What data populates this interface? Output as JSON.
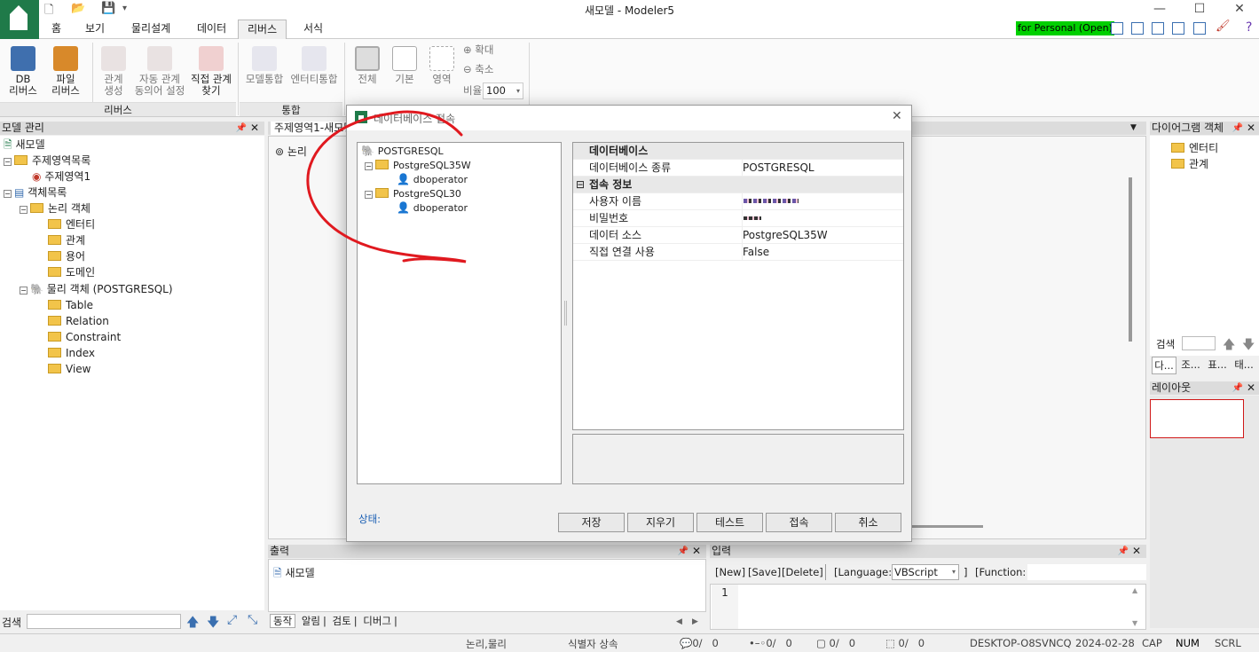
{
  "app": {
    "title": "새모델 - Modeler5",
    "license": "for Personal (Open)"
  },
  "menu": [
    "홈",
    "보기",
    "물리설계",
    "데이터",
    "리버스",
    "서식"
  ],
  "ribbon": {
    "db_reverse": "DB\n리버스",
    "file_reverse": "파일\n리버스",
    "rel_gen": "관계\n생성",
    "auto_rel": "자동 관계\n동의어 설정",
    "direct_rel": "직접 관계\n찾기",
    "group_reverse": "리버스",
    "model_merge": "모델통합",
    "entity_merge": "엔터티통합",
    "group_merge": "통합",
    "full": "전체",
    "basic": "기본",
    "area": "영역",
    "zoom_in": "확대",
    "zoom_out": "축소",
    "ratio_label": "비율",
    "ratio": "100"
  },
  "left_panel": {
    "title": "모델 관리",
    "search_label": "검색",
    "tree": [
      "새모델",
      "주제영역목록",
      "주제영역1",
      "객체목록",
      "논리 객체",
      "엔터티",
      "관계",
      "용어",
      "도메인",
      "물리 객체 (POSTGRESQL)",
      "Table",
      "Relation",
      "Constraint",
      "Index",
      "View"
    ]
  },
  "doc": {
    "tab": "주제영역1-새모델",
    "sub": "논리"
  },
  "right_panel": {
    "title": "다이어그램 객체",
    "items": [
      "엔터티",
      "관계"
    ],
    "search_label": "검색",
    "tabs": [
      "다...",
      "조...",
      "표...",
      "태..."
    ],
    "layout_title": "레이아웃"
  },
  "output": {
    "title": "출력",
    "item": "새모델",
    "tabs": [
      "동작",
      "알림",
      "검토",
      "디버그"
    ]
  },
  "input": {
    "title": "입력",
    "new": "[New]",
    "save": "[Save]",
    "delete": "[Delete]",
    "lang_label": "[Language:",
    "lang": "VBScript",
    "lang_end": "]",
    "func": "[Function:",
    "line": "1"
  },
  "dialog": {
    "title": "데이터베이스 접속",
    "tree": [
      "POSTGRESQL",
      "PostgreSQL35W",
      "dboperator",
      "PostgreSQL30",
      "dboperator"
    ],
    "sections": {
      "db": "데이터베이스",
      "conn": "접속 정보"
    },
    "rows": [
      {
        "k": "데이터베이스 종류",
        "v": "POSTGRESQL"
      },
      {
        "k": "사용자 이름",
        "v": ""
      },
      {
        "k": "비밀번호",
        "v": ""
      },
      {
        "k": "데이터 소스",
        "v": "PostgreSQL35W"
      },
      {
        "k": "직접 연결 사용",
        "v": "False"
      }
    ],
    "status_label": "상태:",
    "buttons": [
      "저장",
      "지우기",
      "테스트",
      "접속",
      "취소"
    ]
  },
  "status": {
    "mode": "논리,물리",
    "ident": "식별자 상속",
    "c1": "0/",
    "c1b": "0",
    "c2": "0/",
    "c2b": "0",
    "c3": "0/",
    "c3b": "0",
    "c4": "0/",
    "c4b": "0",
    "host": "DESKTOP-O8SVNCQ",
    "date": "2024-02-28",
    "cap": "CAP",
    "num": "NUM",
    "scrl": "SCRL"
  },
  "colors": {
    "brand": "#1f7a49",
    "license_bg": "#00d000",
    "annotation": "#e0191f"
  }
}
